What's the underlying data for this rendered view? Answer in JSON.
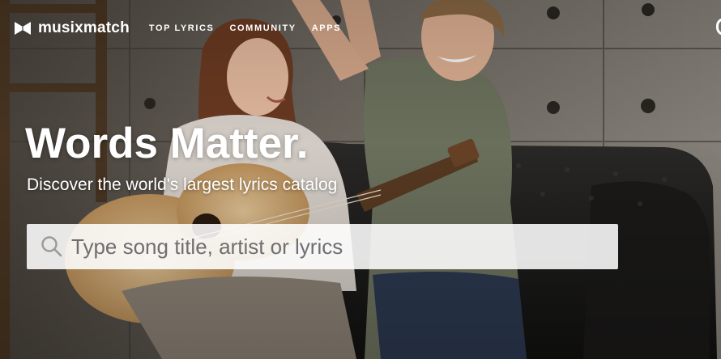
{
  "brand": {
    "name": "musixmatch",
    "logo_icon": "musixmatch-logo-icon"
  },
  "nav": {
    "items": [
      {
        "label": "TOP LYRICS"
      },
      {
        "label": "COMMUNITY"
      },
      {
        "label": "APPS"
      }
    ]
  },
  "hero": {
    "image": "background-photo-couple-with-guitar",
    "headline": "Words Matter.",
    "subheadline": "Discover the world's largest lyrics catalog"
  },
  "search": {
    "icon": "search-icon",
    "placeholder": "Type song title, artist or lyrics",
    "value": ""
  },
  "colors": {
    "text": "#ffffff",
    "search_background": "#ffffff",
    "placeholder": "#6f6f6f",
    "search_icon": "#9a9a9a"
  }
}
